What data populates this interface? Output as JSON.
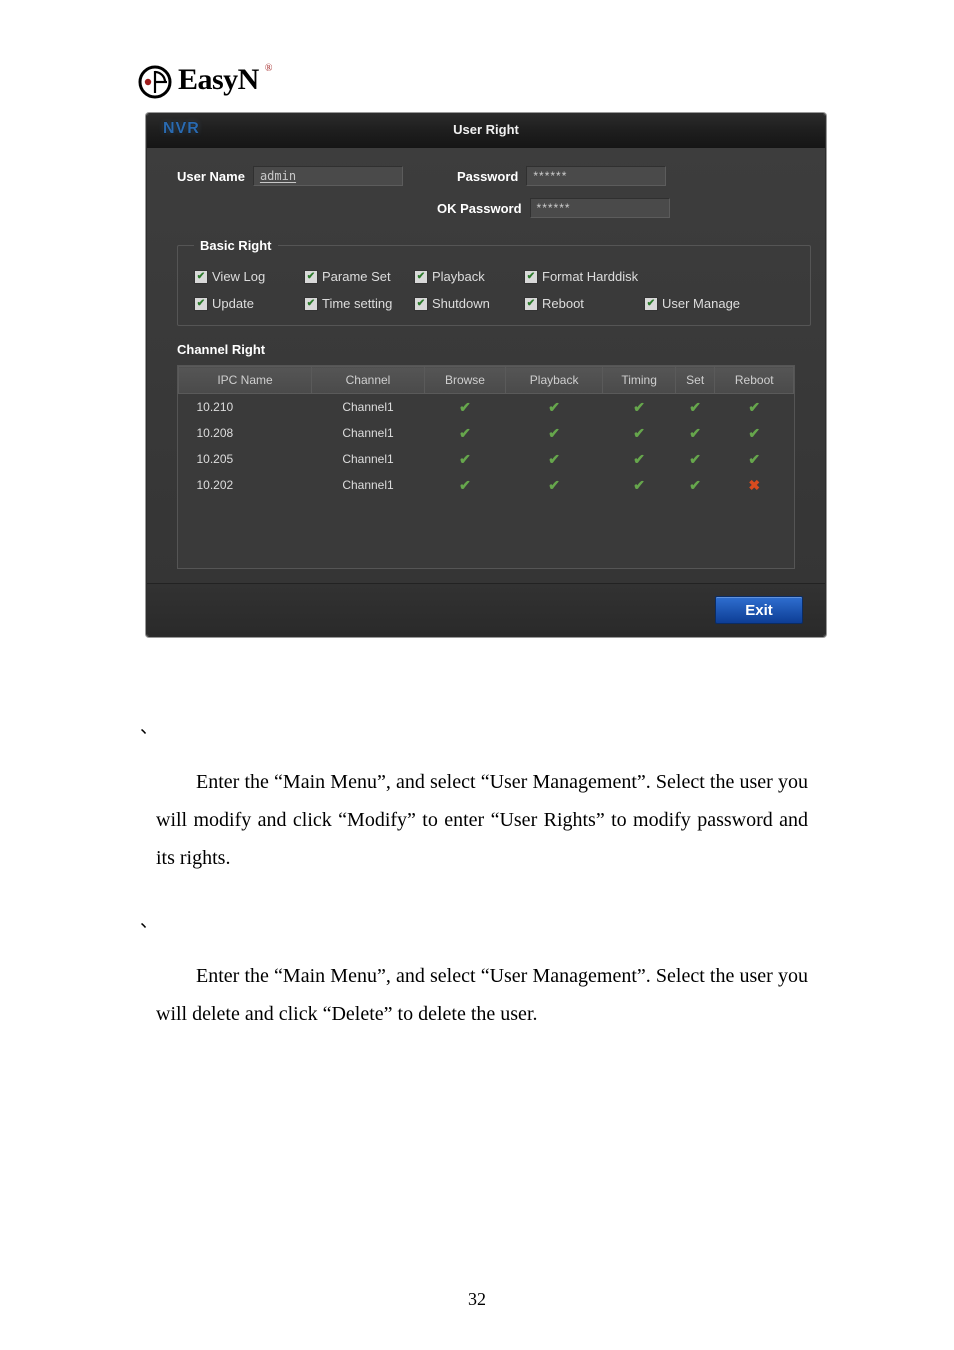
{
  "logo": {
    "brand": "EasyN",
    "mark": "®"
  },
  "dialog": {
    "nvr": "NVR",
    "title": "User Right",
    "user_name_label": "User Name",
    "user_name_value": "admin",
    "password_label": "Password",
    "password_value": "******",
    "ok_password_label": "OK Password",
    "ok_password_value": "******",
    "basic_legend": "Basic Right",
    "basic": {
      "view_log": "View Log",
      "parame_set": "Parame Set",
      "playback": "Playback",
      "format_hd": "Format Harddisk",
      "update": "Update",
      "time_set": "Time setting",
      "shutdown": "Shutdown",
      "reboot": "Reboot",
      "user_mgr": "User Manage"
    },
    "channel_title": "Channel Right",
    "table": {
      "headers": {
        "ipc": "IPC Name",
        "channel": "Channel",
        "browse": "Browse",
        "playback": "Playback",
        "timing": "Timing",
        "set": "Set",
        "reboot": "Reboot"
      },
      "rows": [
        {
          "ipc": "10.210",
          "channel": "Channel1",
          "browse": true,
          "playback": true,
          "timing": true,
          "set": true,
          "reboot": true
        },
        {
          "ipc": "10.208",
          "channel": "Channel1",
          "browse": true,
          "playback": true,
          "timing": true,
          "set": true,
          "reboot": true
        },
        {
          "ipc": "10.205",
          "channel": "Channel1",
          "browse": true,
          "playback": true,
          "timing": true,
          "set": true,
          "reboot": true
        },
        {
          "ipc": "10.202",
          "channel": "Channel1",
          "browse": true,
          "playback": true,
          "timing": true,
          "set": true,
          "reboot": false
        }
      ]
    },
    "exit": "Exit"
  },
  "body": {
    "p1": "Enter the “Main Menu”, and select “User Management”. Select the user you will modify and click “Modify” to enter “User Rights” to modify password and its rights.",
    "p2": "Enter the “Main Menu”, and select “User Management”. Select the user you will delete and click “Delete” to delete the user."
  },
  "page_number": "32",
  "marks": {
    "check": "✔",
    "cross": "✖",
    "backtick": "、"
  }
}
